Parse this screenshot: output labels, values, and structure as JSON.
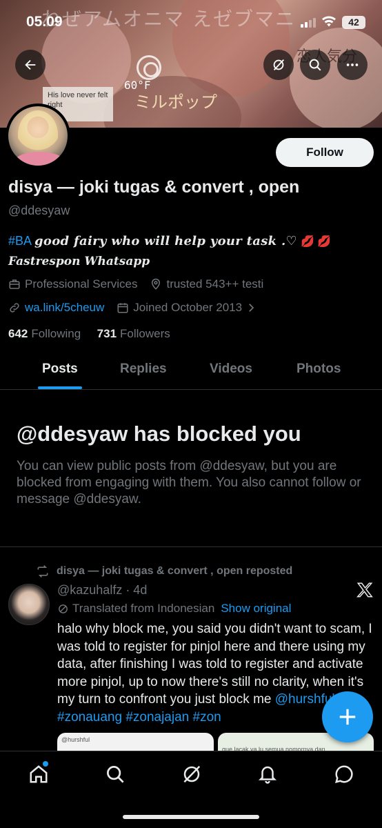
{
  "status_bar": {
    "time": "05.09",
    "battery": "42"
  },
  "banner": {
    "decor_text_1": "ねぜアムオニマ えゼブマニ",
    "decor_text_2": "ミルポップ",
    "decor_text_3": "恋人気分",
    "note_text": "His love never felt right",
    "temperature": "60°F"
  },
  "header_buttons": {
    "back": "back-arrow-icon",
    "grok": "grok-icon",
    "search": "search-icon",
    "more": "more-icon"
  },
  "profile": {
    "follow_label": "Follow",
    "display_name": "disya — joki tugas & convert , open",
    "handle": "@ddesyaw",
    "bio_hashtag": "#BA",
    "bio_text": "good fairy who will help your task .♡",
    "bio_emoji": "💋 💋",
    "bio_line2": "Fastrespon Whatsapp",
    "category": "Professional Services",
    "location": "trusted 543++ testi",
    "website": "wa.link/5cheuw",
    "joined": "Joined October 2013",
    "following_count": "642",
    "following_label": "Following",
    "followers_count": "731",
    "followers_label": "Followers"
  },
  "tabs": [
    {
      "label": "Posts",
      "active": true
    },
    {
      "label": "Replies",
      "active": false
    },
    {
      "label": "Videos",
      "active": false
    },
    {
      "label": "Photos",
      "active": false
    }
  ],
  "blocked": {
    "title": "@ddesyaw has blocked you",
    "body": "You can view public posts from @ddesyaw, but you are blocked from engaging with them. You also cannot follow or message @ddesyaw."
  },
  "post": {
    "repost_label": "disya — joki tugas & convert , open reposted",
    "handle_time": "@kazuhalfz · 4d",
    "translated_label": "Translated from Indonesian",
    "show_original": "Show original",
    "text": "halo why block me, you said you didn't want to scam, I was told to register for pinjol here and there using my data, after finishing I was told to register and activate more pinjol, up to now there's still no clarity, when it's my turn to confront you just block me",
    "links": "@hurshful #zonauang #zonajajan #zon",
    "media_1_caption": "@hurshful",
    "media_2_caption": "gue lacak ya lu semua nomornya dan"
  },
  "bottom_nav": [
    "home-icon",
    "search-icon",
    "grok-icon",
    "notifications-icon",
    "messages-icon"
  ],
  "colors": {
    "accent": "#1d9bf0",
    "background": "#000000",
    "muted": "#71767b",
    "text": "#e7e9ea"
  }
}
